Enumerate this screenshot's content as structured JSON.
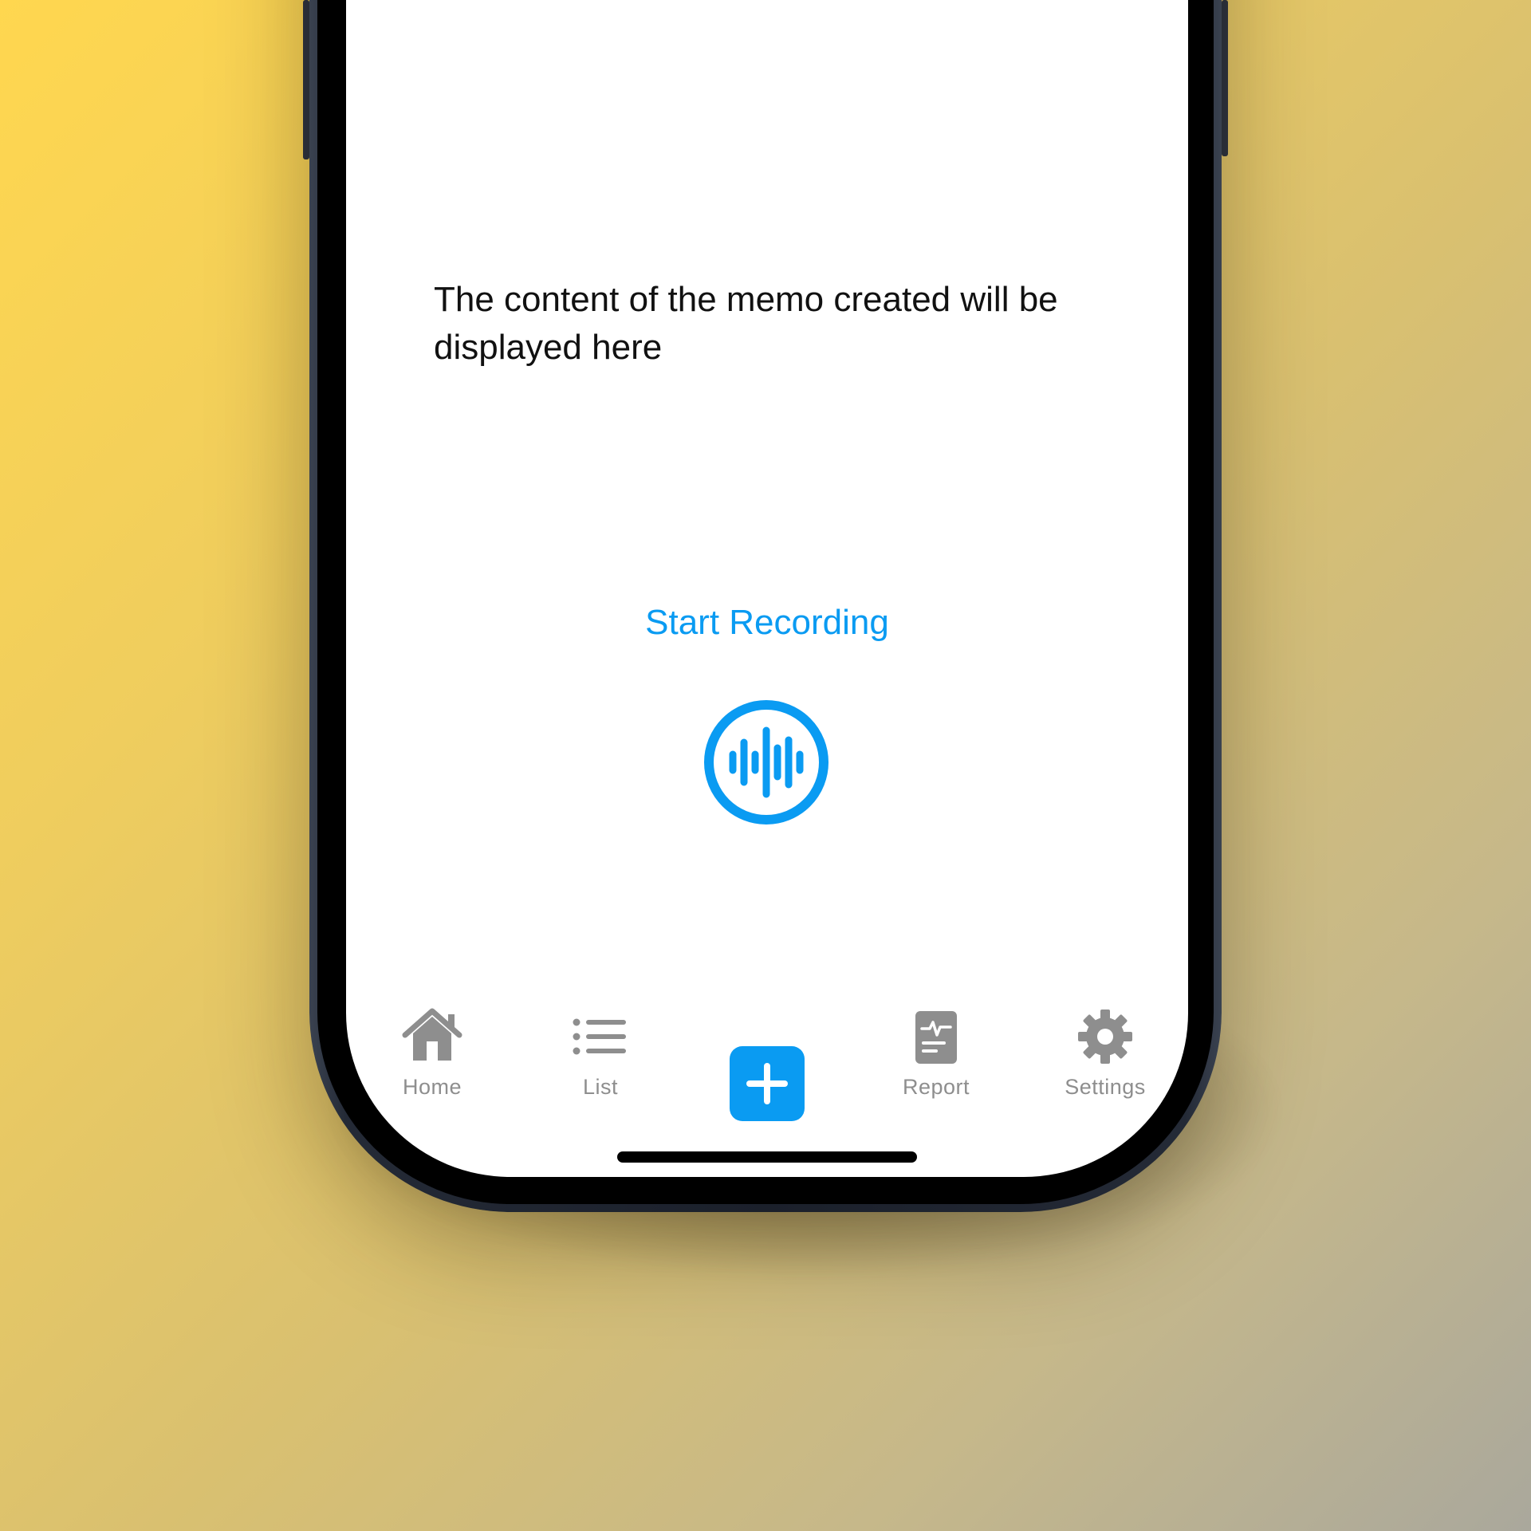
{
  "memo": {
    "placeholder_text": "The content of the memo created will be displayed here"
  },
  "recording": {
    "start_label": "Start Recording",
    "icon": "waveform-circle-icon"
  },
  "tab_bar": {
    "items": [
      {
        "label": "Home",
        "icon": "house-icon"
      },
      {
        "label": "List",
        "icon": "list-icon"
      },
      {
        "label": "",
        "icon": "plus-icon"
      },
      {
        "label": "Report",
        "icon": "report-icon"
      },
      {
        "label": "Settings",
        "icon": "gear-icon"
      }
    ]
  },
  "colors": {
    "accent": "#0a9bf2",
    "tab_inactive": "#8e8e8e",
    "text": "#111111",
    "background_top": "#ffd74f",
    "background_bottom": "#aaa89c"
  }
}
